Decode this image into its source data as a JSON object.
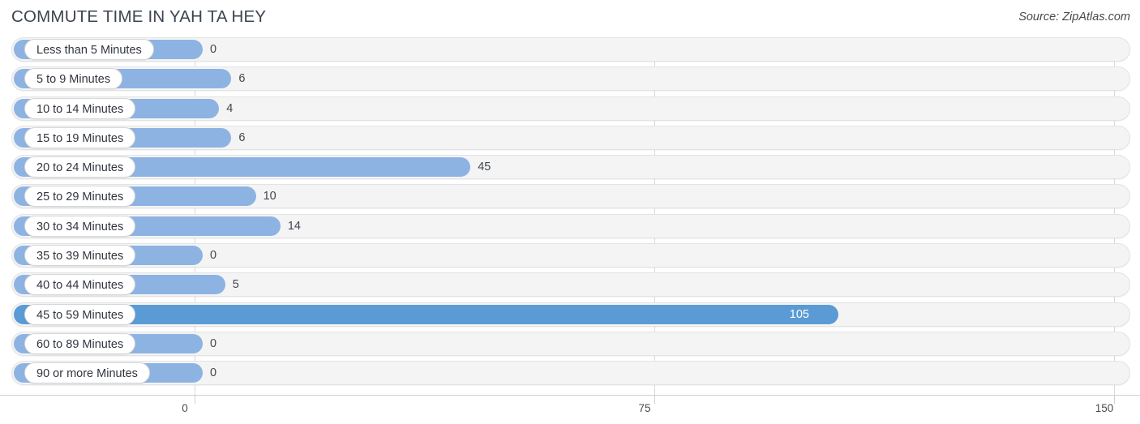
{
  "header": {
    "title": "COMMUTE TIME IN YAH TA HEY",
    "source": "Source: ZipAtlas.com"
  },
  "colors": {
    "bar": "#8db3e2",
    "bar_highlight": "#5b9bd5",
    "track": "#f4f4f4",
    "gridline": "#d9d9d9",
    "title_text": "#3c4450"
  },
  "chart_data": {
    "type": "bar",
    "orientation": "horizontal",
    "title": "COMMUTE TIME IN YAH TA HEY",
    "xlabel": "",
    "ylabel": "",
    "xlim": [
      0,
      150
    ],
    "grid": true,
    "legend": false,
    "xticks": [
      0,
      75,
      150
    ],
    "xtick_labels": [
      "0",
      "75",
      "150"
    ],
    "categories": [
      "Less than 5 Minutes",
      "5 to 9 Minutes",
      "10 to 14 Minutes",
      "15 to 19 Minutes",
      "20 to 24 Minutes",
      "25 to 29 Minutes",
      "30 to 34 Minutes",
      "35 to 39 Minutes",
      "40 to 44 Minutes",
      "45 to 59 Minutes",
      "60 to 89 Minutes",
      "90 or more Minutes"
    ],
    "values": [
      0,
      6,
      4,
      6,
      45,
      10,
      14,
      0,
      5,
      105,
      0,
      0
    ],
    "value_labels": [
      "0",
      "6",
      "4",
      "6",
      "45",
      "10",
      "14",
      "0",
      "5",
      "105",
      "0",
      "0"
    ]
  }
}
